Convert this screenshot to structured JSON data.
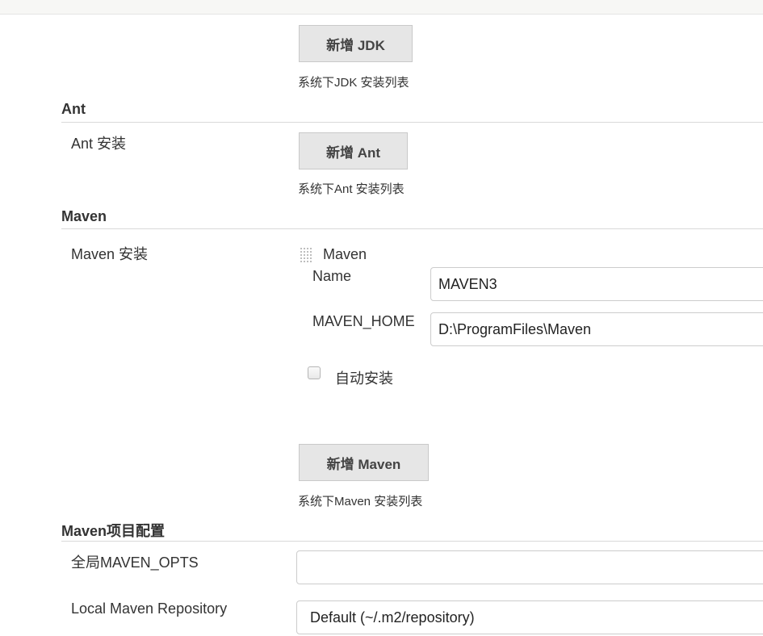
{
  "jdk": {
    "add_button": "新增 JDK",
    "hint": "系统下JDK 安装列表"
  },
  "ant": {
    "section_title": "Ant",
    "install_label": "Ant 安装",
    "add_button": "新增 Ant",
    "hint": "系统下Ant 安装列表"
  },
  "maven": {
    "section_title": "Maven",
    "install_label": "Maven 安装",
    "entry_header": "Maven",
    "name_label": "Name",
    "name_value": "MAVEN3",
    "home_label": "MAVEN_HOME",
    "home_value": "D:\\ProgramFiles\\Maven",
    "auto_install_label": "自动安装",
    "auto_install_checked": false,
    "add_button": "新增 Maven",
    "hint": "系统下Maven 安装列表"
  },
  "maven_project": {
    "section_title": "Maven项目配置",
    "opts_label": "全局MAVEN_OPTS",
    "opts_value": "",
    "repo_label": "Local Maven Repository",
    "repo_value": "Default (~/.m2/repository)"
  }
}
